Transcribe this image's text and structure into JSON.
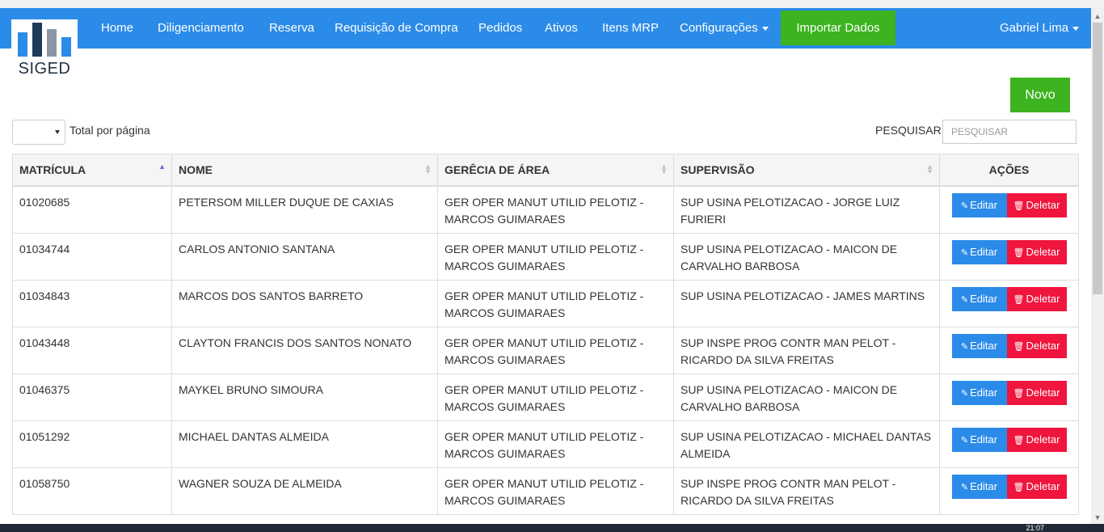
{
  "app": {
    "logo_text": "SIGED"
  },
  "nav": {
    "items": [
      "Home",
      "Diligenciamento",
      "Reserva",
      "Requisição de Compra",
      "Pedidos",
      "Ativos",
      "Itens MRP",
      "Configurações"
    ],
    "import_label": "Importar Dados",
    "user": "Gabriel Lima"
  },
  "toolbar": {
    "new_label": "Novo",
    "per_page_label": "Total por página",
    "search_label": "PESQUISAR:",
    "search_placeholder": "PESQUISAR",
    "search_value": ""
  },
  "table": {
    "headers": [
      "MATRÍCULA",
      "NOME",
      "GERÊCIA DE ÁREA",
      "SUPERVISÃO",
      "AÇÕES"
    ],
    "edit_label": "Editar",
    "delete_label": "Deletar",
    "rows": [
      {
        "matricula": "01020685",
        "nome": "PETERSOM MILLER DUQUE DE CAXIAS",
        "gerencia": "GER OPER MANUT UTILID PELOTIZ - MARCOS GUIMARAES",
        "supervisao": "SUP USINA PELOTIZACAO - JORGE LUIZ FURIERI"
      },
      {
        "matricula": "01034744",
        "nome": "CARLOS ANTONIO SANTANA",
        "gerencia": "GER OPER MANUT UTILID PELOTIZ - MARCOS GUIMARAES",
        "supervisao": "SUP USINA PELOTIZACAO - MAICON DE CARVALHO BARBOSA"
      },
      {
        "matricula": "01034843",
        "nome": "MARCOS DOS SANTOS BARRETO",
        "gerencia": "GER OPER MANUT UTILID PELOTIZ - MARCOS GUIMARAES",
        "supervisao": "SUP USINA PELOTIZACAO - JAMES MARTINS"
      },
      {
        "matricula": "01043448",
        "nome": "CLAYTON FRANCIS DOS SANTOS NONATO",
        "gerencia": "GER OPER MANUT UTILID PELOTIZ - MARCOS GUIMARAES",
        "supervisao": "SUP INSPE PROG CONTR MAN PELOT - RICARDO DA SILVA FREITAS"
      },
      {
        "matricula": "01046375",
        "nome": "MAYKEL BRUNO SIMOURA",
        "gerencia": "GER OPER MANUT UTILID PELOTIZ - MARCOS GUIMARAES",
        "supervisao": "SUP USINA PELOTIZACAO - MAICON DE CARVALHO BARBOSA"
      },
      {
        "matricula": "01051292",
        "nome": "MICHAEL DANTAS ALMEIDA",
        "gerencia": "GER OPER MANUT UTILID PELOTIZ - MARCOS GUIMARAES",
        "supervisao": "SUP USINA PELOTIZACAO - MICHAEL DANTAS ALMEIDA"
      },
      {
        "matricula": "01058750",
        "nome": "WAGNER SOUZA DE ALMEIDA",
        "gerencia": "GER OPER MANUT UTILID PELOTIZ - MARCOS GUIMARAES",
        "supervisao": "SUP INSPE PROG CONTR MAN PELOT - RICARDO DA SILVA FREITAS"
      }
    ]
  },
  "system": {
    "clock": "21:07"
  },
  "colors": {
    "navbar": "#2b8be8",
    "accent_green": "#3cb31f",
    "delete_red": "#f0153d"
  }
}
